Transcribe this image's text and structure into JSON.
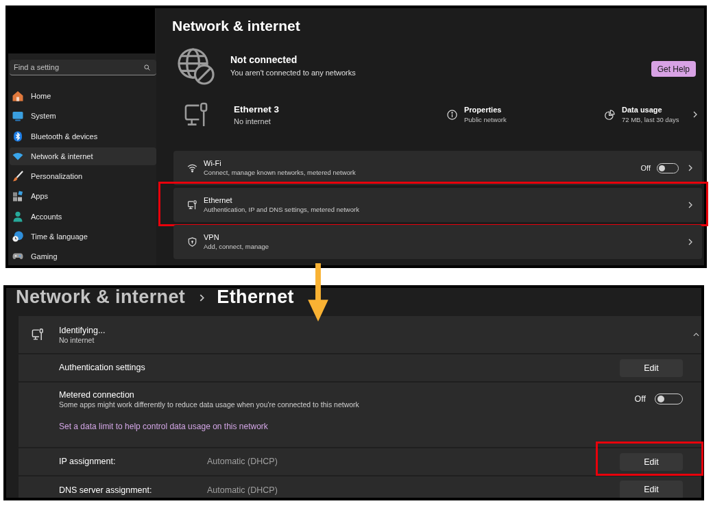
{
  "top_window": {
    "sidebar": {
      "search": {
        "placeholder": "Find a setting"
      },
      "items": [
        {
          "label": "Home",
          "selected": false
        },
        {
          "label": "System",
          "selected": false
        },
        {
          "label": "Bluetooth & devices",
          "selected": false
        },
        {
          "label": "Network & internet",
          "selected": true
        },
        {
          "label": "Personalization",
          "selected": false
        },
        {
          "label": "Apps",
          "selected": false
        },
        {
          "label": "Accounts",
          "selected": false
        },
        {
          "label": "Time & language",
          "selected": false
        },
        {
          "label": "Gaming",
          "selected": false
        }
      ]
    },
    "page_title": "Network & internet",
    "status": {
      "title": "Not connected",
      "subtitle": "You aren't connected to any networks",
      "help_button": "Get Help"
    },
    "adapter": {
      "name": "Ethernet 3",
      "status": "No internet",
      "properties": {
        "label": "Properties",
        "value": "Public network"
      },
      "data_usage": {
        "label": "Data usage",
        "value": "72 MB, last 30 days"
      }
    },
    "settings": [
      {
        "kind": "wifi",
        "title": "Wi-Fi",
        "description": "Connect, manage known networks, metered network",
        "state_label": "Off",
        "on": false,
        "highlighted": false
      },
      {
        "kind": "ethernet",
        "title": "Ethernet",
        "description": "Authentication, IP and DNS settings, metered network",
        "highlighted": true
      },
      {
        "kind": "vpn",
        "title": "VPN",
        "description": "Add, connect, manage",
        "highlighted": false
      }
    ]
  },
  "bottom_window": {
    "breadcrumb": [
      {
        "label": "Network & internet",
        "current": false
      },
      {
        "label": "Ethernet",
        "current": true
      }
    ],
    "connection": {
      "name": "Identifying...",
      "status": "No internet",
      "expanded": true
    },
    "rows": [
      {
        "kind": "button",
        "label": "Authentication settings",
        "button": "Edit",
        "highlighted": false
      },
      {
        "kind": "toggle",
        "label": "Metered connection",
        "description": "Some apps might work differently to reduce data usage when you're connected to this network",
        "state_label": "Off",
        "on": false,
        "link": "Set a data limit to help control data usage on this network",
        "highlighted": false
      },
      {
        "kind": "value",
        "label": "IP assignment:",
        "value": "Automatic (DHCP)",
        "button": "Edit",
        "highlighted": true
      },
      {
        "kind": "value",
        "label": "DNS server assignment:",
        "value": "Automatic (DHCP)",
        "button": "Edit",
        "highlighted": false
      }
    ]
  }
}
